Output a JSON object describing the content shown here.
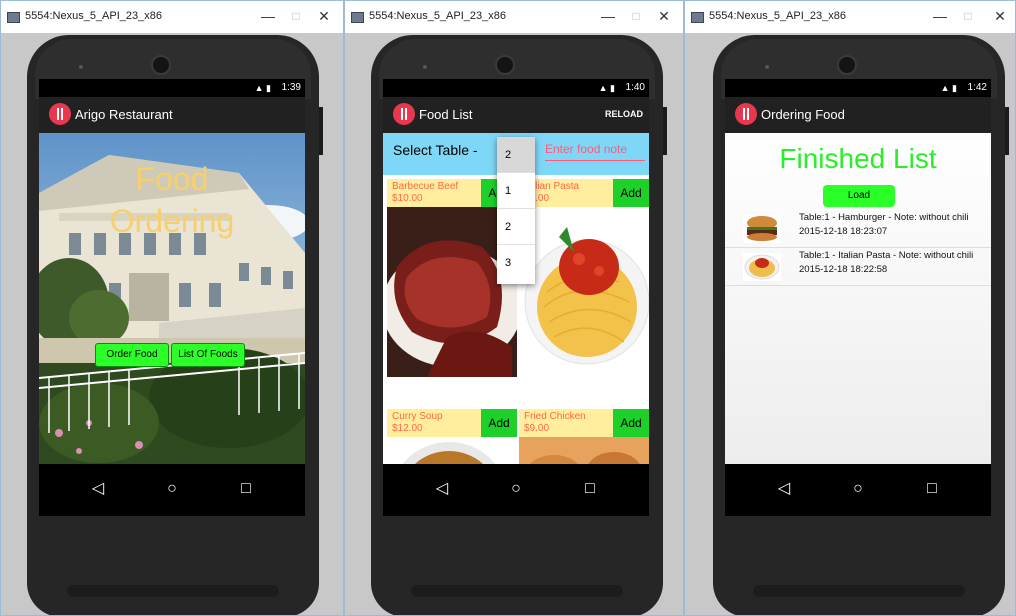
{
  "windows": [
    {
      "title": "5554:Nexus_5_API_23_x86"
    },
    {
      "title": "5554:Nexus_5_API_23_x86"
    },
    {
      "title": "5554:Nexus_5_API_23_x86"
    }
  ],
  "window_controls": {
    "minimize": "—",
    "maximize": "□",
    "close": "✕"
  },
  "screen1": {
    "time": "1:39",
    "app_title": "Arigo Restaurant",
    "hero_line1": "Food",
    "hero_line2": "Ordering",
    "order_food_button": "Order Food",
    "list_foods_button": "List Of Foods"
  },
  "screen2": {
    "time": "1:40",
    "app_title": "Food List",
    "reload": "RELOAD",
    "select_table_label": "Select Table -",
    "note_placeholder": "Enter food note",
    "dropdown": {
      "selected": "2",
      "options": [
        "1",
        "2",
        "3"
      ]
    },
    "foods": [
      {
        "name": "Barbecue Beef",
        "price": "$10.00",
        "add": "Add"
      },
      {
        "name": "Italian Pasta",
        "price": "$9.00",
        "add": "Add"
      },
      {
        "name": "Curry Soup",
        "price": "$12.00",
        "add": "Add"
      },
      {
        "name": "Fried Chicken",
        "price": "$9.00",
        "add": "Add"
      }
    ]
  },
  "screen3": {
    "time": "1:42",
    "app_title": "Ordering Food",
    "heading": "Finished List",
    "load_button": "Load",
    "orders": [
      {
        "line1": "Table:1 - Hamburger - Note: without chili",
        "line2": "2015-12-18 18:23:07"
      },
      {
        "line1": "Table:1 - Italian Pasta - Note: without chili",
        "line2": "2015-12-18 18:22:58"
      }
    ]
  },
  "colors": {
    "accent_green": "#2bff28",
    "select_bar": "#7fd7f7",
    "price_text": "#ff6a4a",
    "logo_red": "#e8384f"
  }
}
